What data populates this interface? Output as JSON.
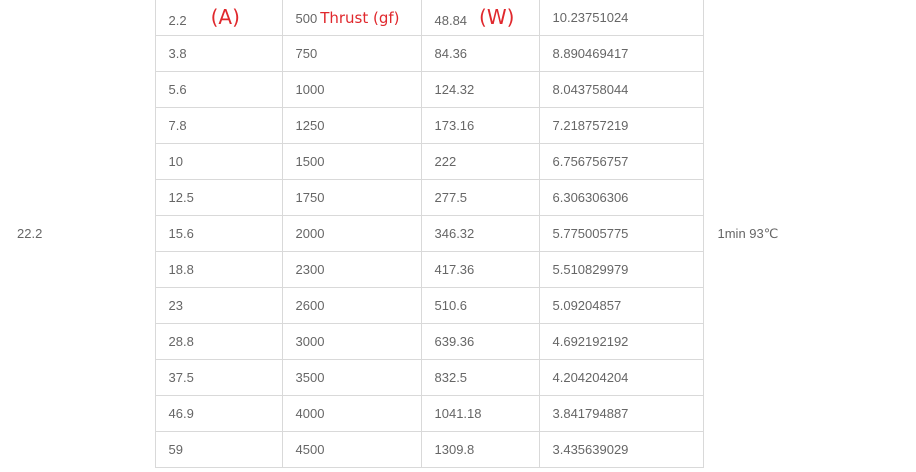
{
  "table": {
    "voltage": "22.2",
    "note": "1min 93℃",
    "annotations": {
      "current_unit": "(A)",
      "thrust_label": "Thrust (gf)",
      "power_unit": "(W)"
    },
    "rows": [
      {
        "current": "2.2",
        "thrust": "500",
        "power": "48.84",
        "efficiency": "10.23751024"
      },
      {
        "current": "3.8",
        "thrust": "750",
        "power": "84.36",
        "efficiency": "8.890469417"
      },
      {
        "current": "5.6",
        "thrust": "1000",
        "power": "124.32",
        "efficiency": "8.043758044"
      },
      {
        "current": "7.8",
        "thrust": "1250",
        "power": "173.16",
        "efficiency": "7.218757219"
      },
      {
        "current": "10",
        "thrust": "1500",
        "power": "222",
        "efficiency": "6.756756757"
      },
      {
        "current": "12.5",
        "thrust": "1750",
        "power": "277.5",
        "efficiency": "6.306306306"
      },
      {
        "current": "15.6",
        "thrust": "2000",
        "power": "346.32",
        "efficiency": "5.775005775"
      },
      {
        "current": "18.8",
        "thrust": "2300",
        "power": "417.36",
        "efficiency": "5.510829979"
      },
      {
        "current": "23",
        "thrust": "2600",
        "power": "510.6",
        "efficiency": "5.09204857"
      },
      {
        "current": "28.8",
        "thrust": "3000",
        "power": "639.36",
        "efficiency": "4.692192192"
      },
      {
        "current": "37.5",
        "thrust": "3500",
        "power": "832.5",
        "efficiency": "4.204204204"
      },
      {
        "current": "46.9",
        "thrust": "4000",
        "power": "1041.18",
        "efficiency": "3.841794887"
      },
      {
        "current": "59",
        "thrust": "4500",
        "power": "1309.8",
        "efficiency": "3.435639029"
      }
    ]
  }
}
